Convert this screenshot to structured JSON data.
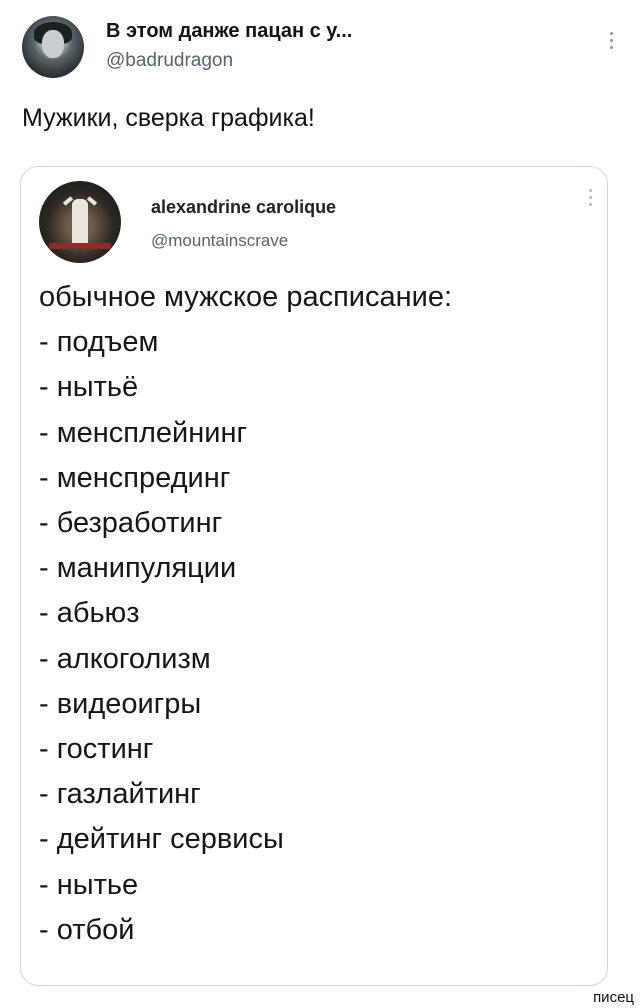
{
  "tweet": {
    "author_name": "В этом данже пацан с у...",
    "author_handle": "@badrudragon",
    "text": "Мужики, сверка графика!"
  },
  "quoted_tweet": {
    "author_name": "alexandrine carolique",
    "author_handle": "@mountainscrave",
    "lines": [
      "обычное мужское расписание:",
      "- подъем",
      "- нытьё",
      "- менсплейнинг",
      "- менспрединг",
      "- безработинг",
      "- манипуляции",
      "- абьюз",
      "- алкоголизм",
      "- видеоигры",
      "- гостинг",
      "- газлайтинг",
      "- дейтинг сервисы",
      "- нытье",
      "- отбой"
    ]
  },
  "icons": {
    "tweet_more": "more-vertical-icon",
    "quote_more": "more-vertical-icon"
  },
  "watermark": "писец"
}
